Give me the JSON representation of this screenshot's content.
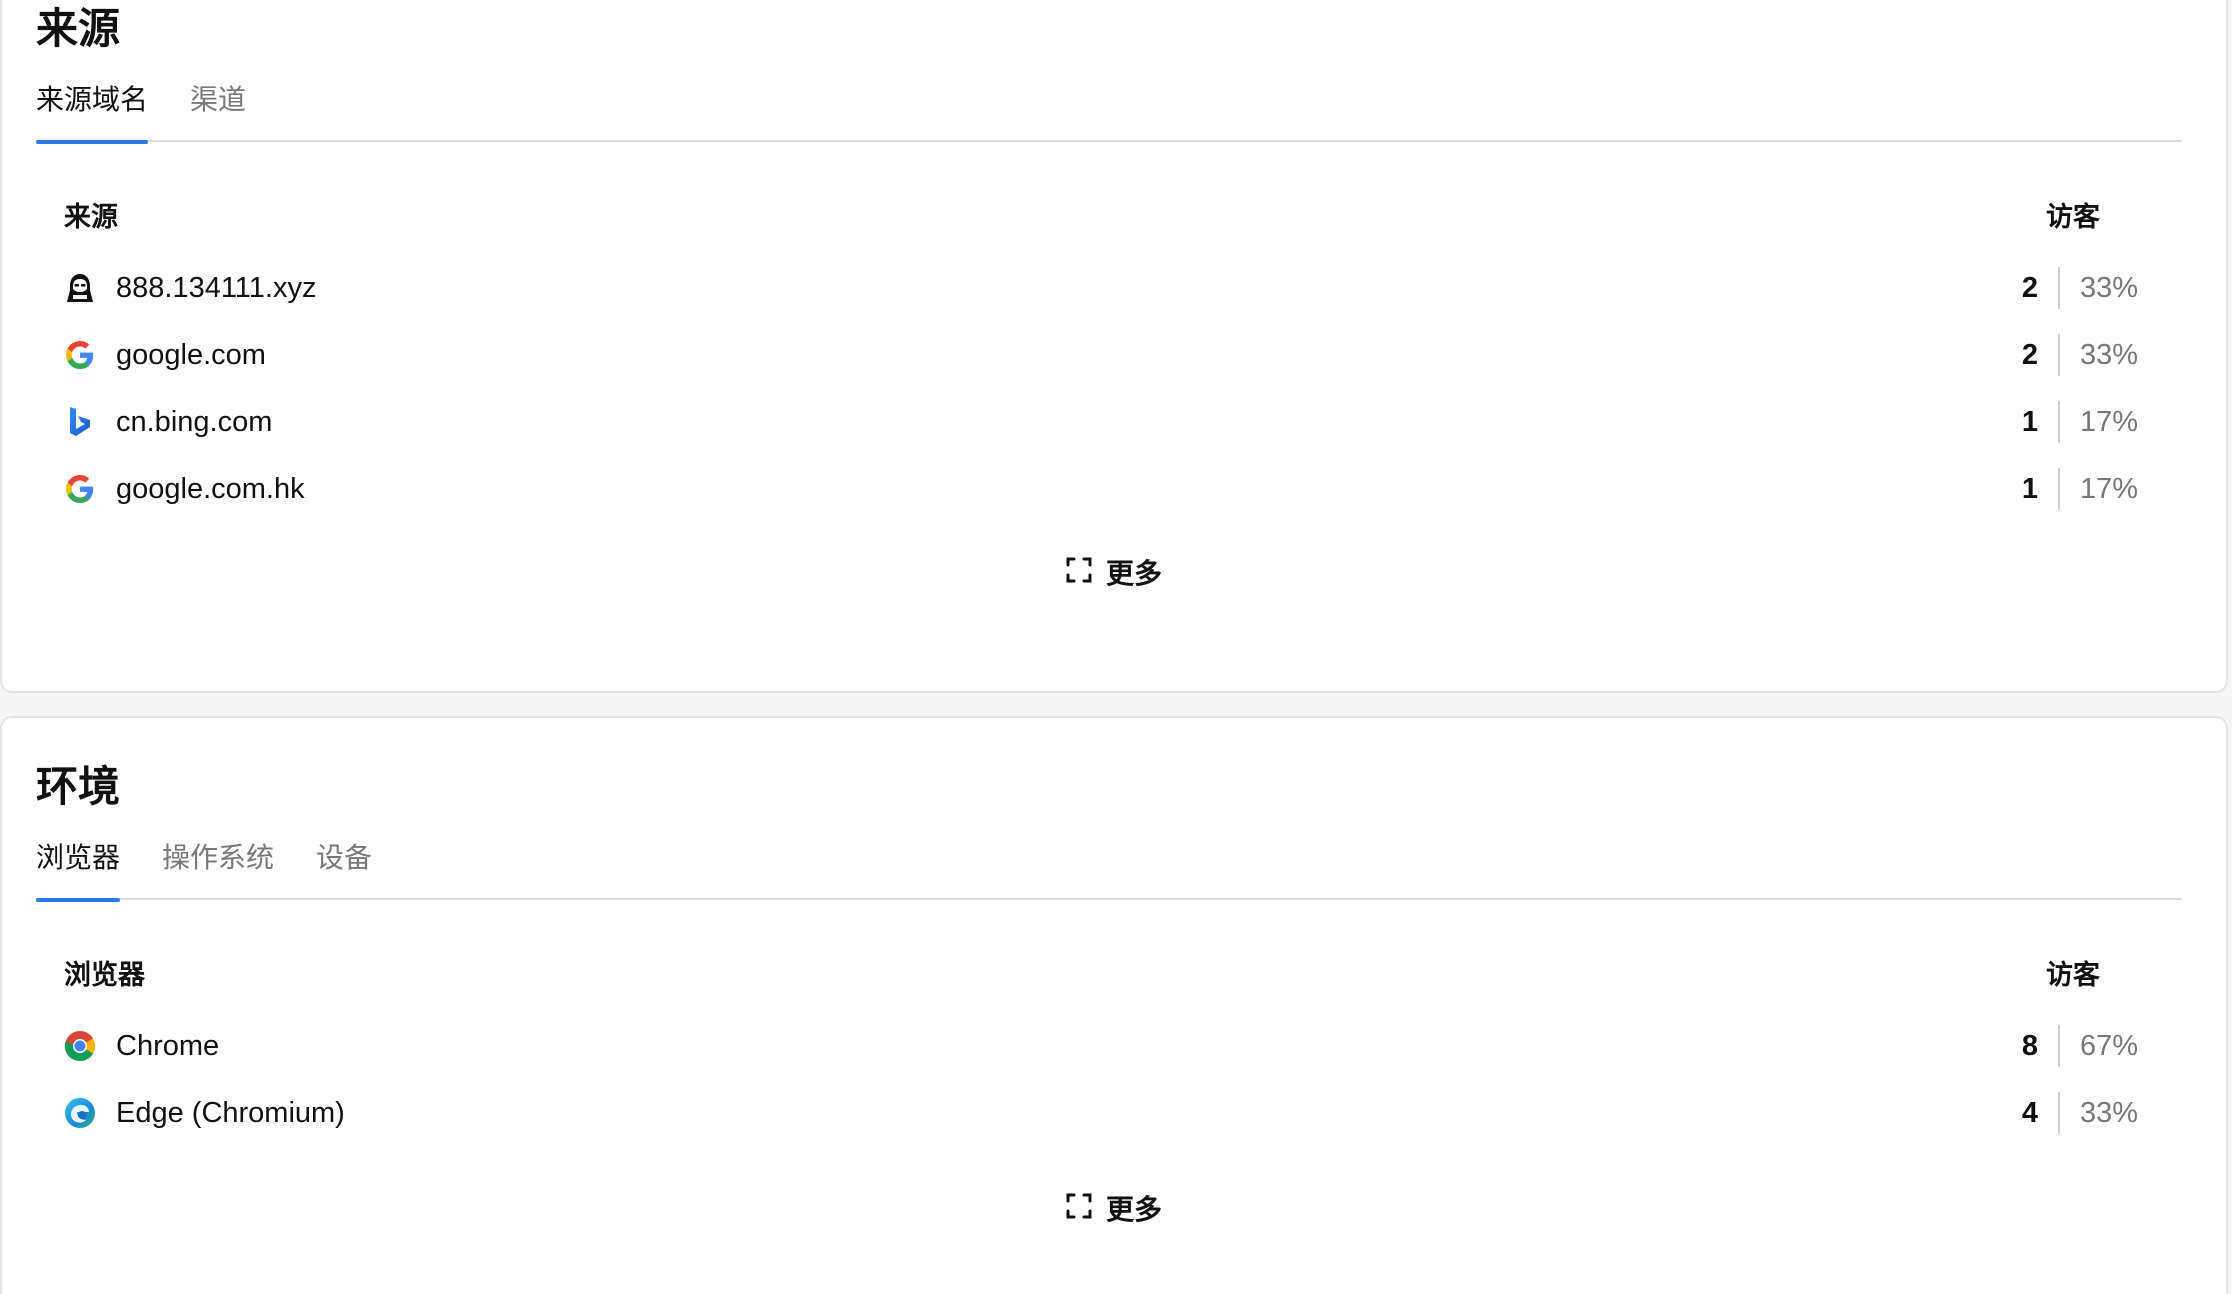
{
  "sources": {
    "title": "来源",
    "tabs": [
      {
        "label": "来源域名",
        "active": true
      },
      {
        "label": "渠道",
        "active": false
      }
    ],
    "col_name": "来源",
    "col_visitors": "访客",
    "rows": [
      {
        "icon": "hacker-icon",
        "label": "888.134111.xyz",
        "count": "2",
        "pct": "33%"
      },
      {
        "icon": "google-icon",
        "label": "google.com",
        "count": "2",
        "pct": "33%"
      },
      {
        "icon": "bing-icon",
        "label": "cn.bing.com",
        "count": "1",
        "pct": "17%"
      },
      {
        "icon": "google-icon",
        "label": "google.com.hk",
        "count": "1",
        "pct": "17%"
      }
    ],
    "more_label": "更多"
  },
  "environment": {
    "title": "环境",
    "tabs": [
      {
        "label": "浏览器",
        "active": true
      },
      {
        "label": "操作系统",
        "active": false
      },
      {
        "label": "设备",
        "active": false
      }
    ],
    "col_name": "浏览器",
    "col_visitors": "访客",
    "rows": [
      {
        "icon": "chrome-icon",
        "label": "Chrome",
        "count": "8",
        "pct": "67%"
      },
      {
        "icon": "edge-icon",
        "label": "Edge (Chromium)",
        "count": "4",
        "pct": "33%"
      }
    ],
    "more_label": "更多"
  },
  "colors": {
    "accent": "#2c7be5",
    "muted_text": "#777777",
    "border": "#e3e3e3"
  }
}
